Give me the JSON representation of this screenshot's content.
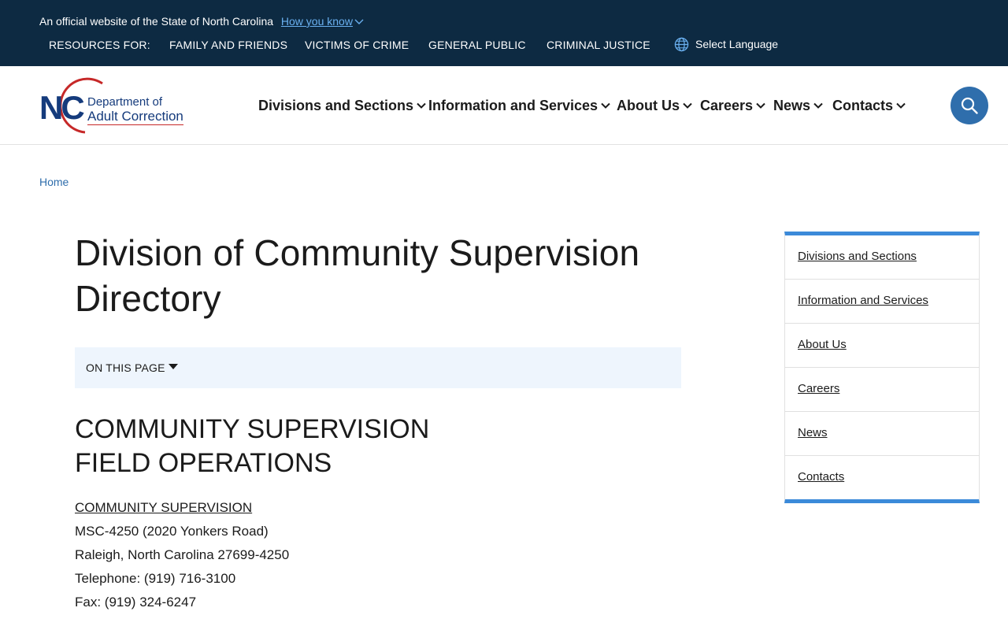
{
  "topbar": {
    "official_text": "An official website of the State of North Carolina",
    "how_you_know": "How you know",
    "resources_label": "RESOURCES FOR:",
    "resources": [
      "FAMILY AND FRIENDS",
      "VICTIMS OF CRIME",
      "GENERAL PUBLIC",
      "CRIMINAL JUSTICE"
    ],
    "language_label": "Select Language"
  },
  "logo": {
    "nc": "NC",
    "line1": "Department of",
    "line2": "Adult Correction"
  },
  "nav": {
    "items": [
      "Divisions and Sections",
      "Information and Services",
      "About Us",
      "Careers",
      "News",
      "Contacts"
    ]
  },
  "breadcrumb": {
    "home": "Home"
  },
  "main": {
    "title_line1": "Division of Community Supervision",
    "title_line2": "Directory",
    "on_this_page": "ON THIS PAGE",
    "section_line1": "COMMUNITY SUPERVISION",
    "section_line2": "FIELD OPERATIONS",
    "address": {
      "org": "COMMUNITY SUPERVISION",
      "line1": "MSC-4250 (2020 Yonkers Road)",
      "line2": "Raleigh, North Carolina 27699-4250",
      "telephone": "Telephone: (919) 716-3100",
      "fax": "Fax: (919) 324-6247"
    }
  },
  "sidebar": {
    "items": [
      "Divisions and Sections",
      "Information and Services",
      "About Us",
      "Careers",
      "News",
      "Contacts"
    ]
  },
  "colors": {
    "topbar_bg": "#0d2a42",
    "link_blue": "#2f6eac",
    "sidebar_accent": "#3b8ad9",
    "onpage_bg": "#eef5fd",
    "logo_navy": "#153b7c",
    "logo_red": "#c62828"
  },
  "icons": [
    "chevron-down-icon",
    "globe-icon",
    "search-icon",
    "caret-down-icon"
  ]
}
